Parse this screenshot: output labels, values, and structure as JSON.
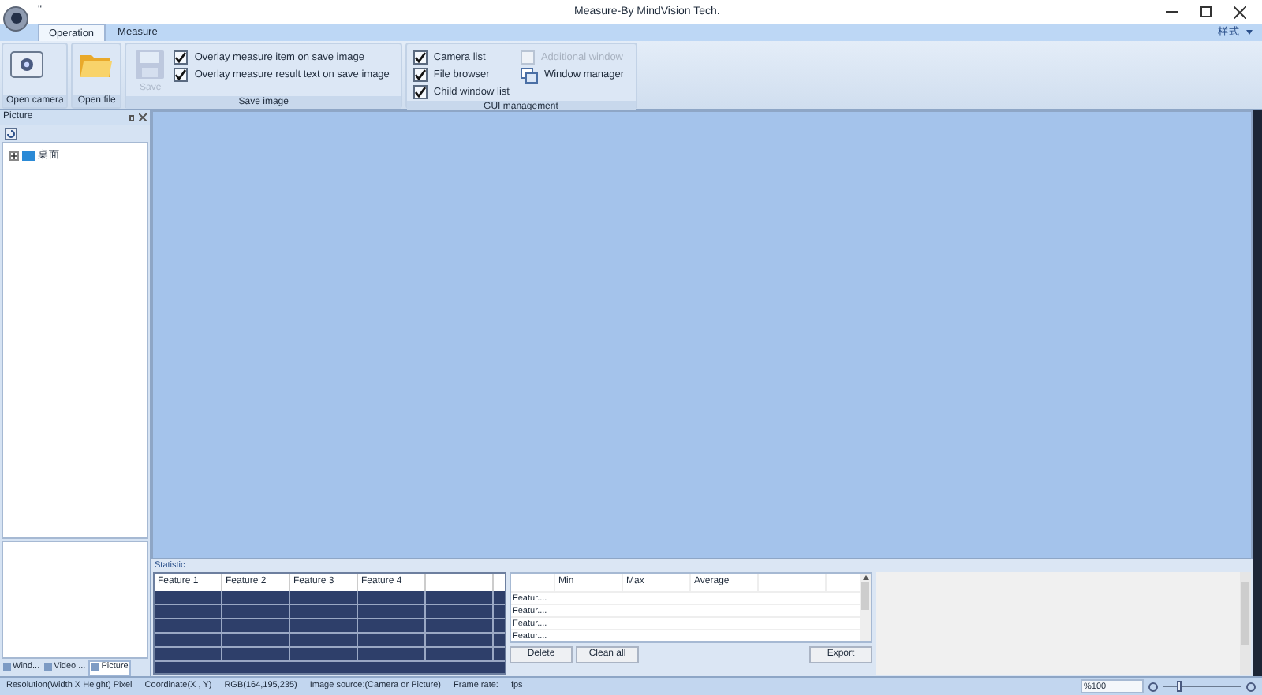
{
  "window": {
    "title": "Measure-By MindVision Tech.",
    "quick_access": "\""
  },
  "tabs": [
    {
      "label": "Operation",
      "selected": true
    },
    {
      "label": "Measure",
      "selected": false
    }
  ],
  "style_menu": "样式",
  "ribbon": {
    "groups": [
      {
        "label": "Open camera",
        "items": [
          {
            "kind": "camera"
          }
        ]
      },
      {
        "label": "Open file",
        "items": [
          {
            "kind": "folder"
          }
        ]
      },
      {
        "label": "Save image",
        "items": [
          {
            "kind": "save",
            "label": "Save",
            "disabled": true
          },
          {
            "kind": "checks",
            "checks": [
              {
                "kind": "checkbox",
                "label": "Overlay measure item on save image",
                "checked": true,
                "disabled": false
              },
              {
                "kind": "checkbox",
                "label": "Overlay measure result text on save image",
                "checked": true,
                "disabled": false
              }
            ]
          }
        ]
      },
      {
        "label": "GUI management",
        "items": [
          {
            "kind": "checks",
            "checks": [
              {
                "kind": "checkbox",
                "label": "Camera list",
                "checked": true,
                "disabled": false
              },
              {
                "kind": "checkbox",
                "label": "File browser",
                "checked": true,
                "disabled": false
              },
              {
                "kind": "checkbox",
                "label": "Child window list",
                "checked": true,
                "disabled": false
              }
            ]
          },
          {
            "kind": "checks",
            "checks": [
              {
                "kind": "checkbox",
                "label": "Additional window",
                "checked": false,
                "disabled": true
              },
              {
                "kind": "command",
                "label": "Window manager"
              }
            ]
          }
        ]
      }
    ]
  },
  "left_panel": {
    "title": "Picture",
    "tree": [
      {
        "label": "桌面",
        "expanded": false
      }
    ],
    "tabs": [
      {
        "label": "Wind...",
        "selected": false
      },
      {
        "label": "Video ...",
        "selected": false
      },
      {
        "label": "Picture",
        "selected": true
      }
    ]
  },
  "statistic": {
    "title": "Statistic",
    "feature_columns": [
      "Feature 1",
      "Feature 2",
      "Feature 3",
      "Feature 4",
      ""
    ],
    "summary_columns": [
      "",
      "Min",
      "Max",
      "Average",
      ""
    ],
    "summary_rows": [
      "Featur....",
      "Featur....",
      "Featur....",
      "Featur...."
    ],
    "buttons": [
      "Delete",
      "Clean all",
      "Export"
    ]
  },
  "status_bar": {
    "items": [
      "Resolution(Width X Height) Pixel",
      "Coordinate(X , Y)",
      "RGB(164,195,235)",
      "Image source:(Camera  or  Picture)",
      "Frame rate:",
      "fps"
    ],
    "zoom": "%100",
    "zoom_slider": {
      "level": 0.17
    }
  }
}
